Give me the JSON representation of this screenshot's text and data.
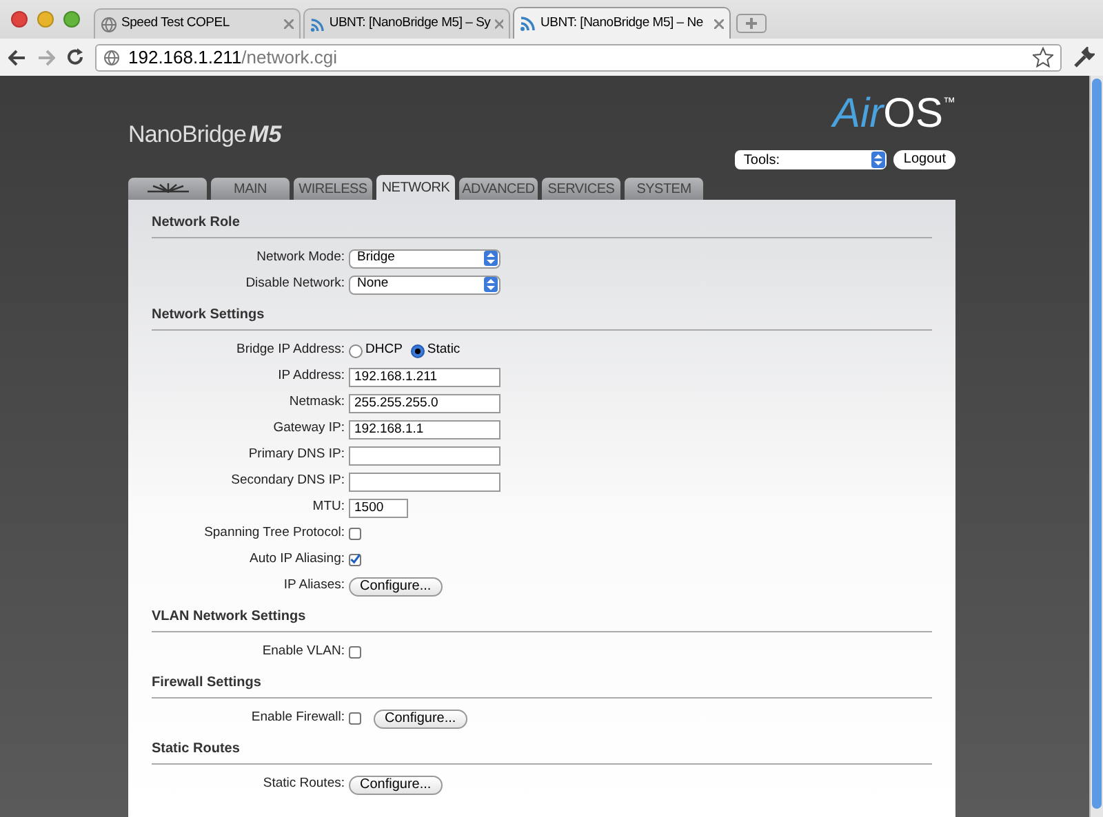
{
  "browser": {
    "tabs": [
      {
        "title": "Speed Test COPEL",
        "kind": "globe",
        "selected": false
      },
      {
        "title": "UBNT: [NanoBridge M5] – Sy",
        "kind": "signal",
        "selected": false
      },
      {
        "title": "UBNT: [NanoBridge M5] – Ne",
        "kind": "signal",
        "selected": true
      }
    ],
    "url_host": "192.168.1.211",
    "url_path": "/network.cgi"
  },
  "header": {
    "product": "NanoBridge",
    "model": "M5",
    "logo_prefix": "Air",
    "logo_suffix": "OS",
    "logo_mark": "™",
    "tools": "Tools:",
    "logout": "Logout"
  },
  "nav_tabs": [
    {
      "kind": "logo",
      "selected": false
    },
    {
      "label": "MAIN",
      "kind": "text",
      "selected": false
    },
    {
      "label": "WIRELESS",
      "kind": "text",
      "selected": false
    },
    {
      "label": "NETWORK",
      "kind": "text",
      "selected": true
    },
    {
      "label": "ADVANCED",
      "kind": "text",
      "selected": false
    },
    {
      "label": "SERVICES",
      "kind": "text",
      "selected": false
    },
    {
      "label": "SYSTEM",
      "kind": "text",
      "selected": false
    }
  ],
  "sections": [
    {
      "title": "Network Role",
      "rows": [
        {
          "kind": "select",
          "label": "Network Mode:",
          "value": "Bridge"
        },
        {
          "kind": "select",
          "label": "Disable Network:",
          "value": "None"
        }
      ]
    },
    {
      "title": "Network Settings",
      "rows": [
        {
          "kind": "radio",
          "label": "Bridge IP Address:",
          "options": [
            {
              "label": "DHCP",
              "selected": false
            },
            {
              "label": "Static",
              "selected": true
            }
          ]
        },
        {
          "kind": "text",
          "label": "IP Address:",
          "value": "192.168.1.211"
        },
        {
          "kind": "text",
          "label": "Netmask:",
          "value": "255.255.255.0"
        },
        {
          "kind": "text",
          "label": "Gateway IP:",
          "value": "192.168.1.1"
        },
        {
          "kind": "text",
          "label": "Primary DNS IP:"
        },
        {
          "kind": "text",
          "label": "Secondary DNS IP:"
        },
        {
          "kind": "short",
          "label": "MTU:",
          "value": "1500"
        },
        {
          "kind": "checkbox",
          "label": "Spanning Tree Protocol:",
          "checked": false
        },
        {
          "kind": "checkbox",
          "label": "Auto IP Aliasing:",
          "checked": true
        },
        {
          "kind": "button",
          "label": "IP Aliases:",
          "button": "Configure..."
        }
      ]
    },
    {
      "title": "VLAN Network Settings",
      "rows": [
        {
          "kind": "checkbox",
          "label": "Enable VLAN:",
          "checked": false
        }
      ]
    },
    {
      "title": "Firewall Settings",
      "rows": [
        {
          "kind": "checkbox",
          "label": "Enable Firewall:",
          "checked": false,
          "button": "Configure..."
        }
      ]
    },
    {
      "title": "Static Routes",
      "rows": [
        {
          "kind": "button",
          "label": "Static Routes:",
          "button": "Configure..."
        }
      ]
    }
  ]
}
